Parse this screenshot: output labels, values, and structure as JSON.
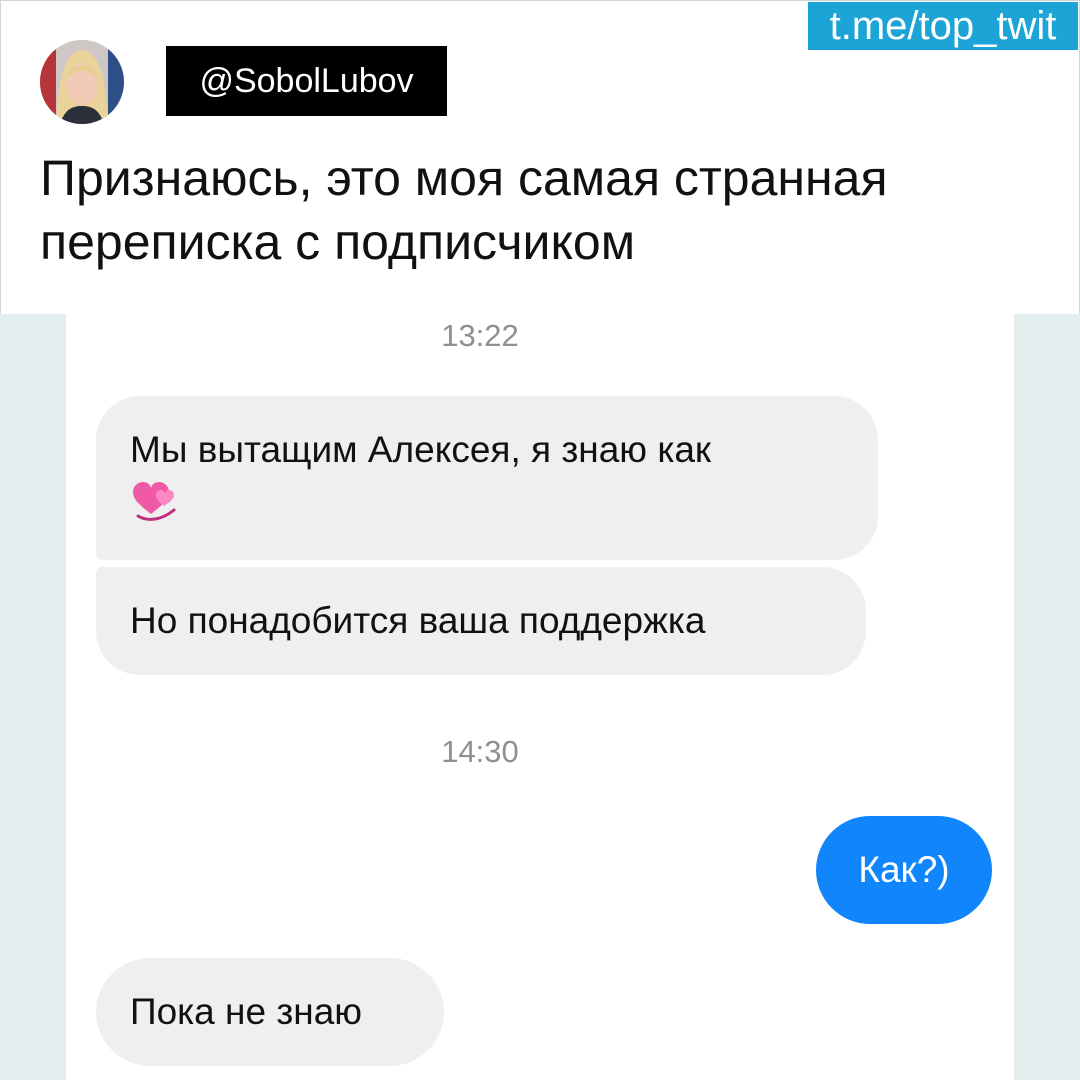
{
  "channel": {
    "link": "t.me/top_twit"
  },
  "tweet": {
    "author_handle": "@SobolLubov",
    "text": "Признаюсь, это моя самая странная переписка с подписчиком"
  },
  "conversation": {
    "timestamps": [
      "13:22",
      "14:30"
    ],
    "messages": [
      {
        "sender": "incoming",
        "text": "Мы вытащим Алексея, я знаю как",
        "emoji": "revolving-hearts-icon"
      },
      {
        "sender": "incoming",
        "text": "Но понадобится ваша поддержка"
      },
      {
        "sender": "outgoing",
        "text": "Как?)"
      },
      {
        "sender": "incoming",
        "text": "Пока не знаю"
      }
    ]
  },
  "colors": {
    "channel_tag_bg": "#1ca4d6",
    "incoming_bubble": "#efefef",
    "outgoing_bubble": "#1185fb",
    "chat_side_bg": "#e3eeee"
  }
}
